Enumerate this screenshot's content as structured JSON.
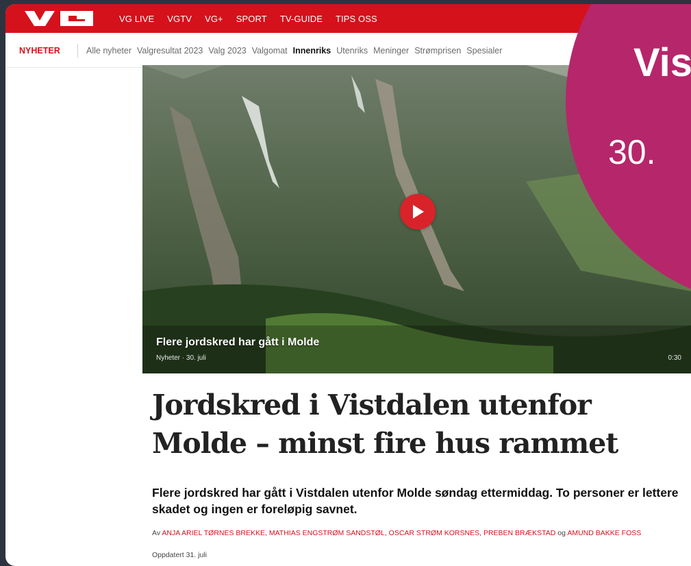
{
  "brand": {
    "logo_text": "VG",
    "accent": "#d5111b",
    "badge_color": "#b6266a"
  },
  "topnav": {
    "items": [
      {
        "label": "VG LIVE"
      },
      {
        "label": "VGTV"
      },
      {
        "label": "VG+"
      },
      {
        "label": "SPORT"
      },
      {
        "label": "TV-GUIDE"
      },
      {
        "label": "TIPS OSS"
      }
    ]
  },
  "secnav": {
    "section": "NYHETER",
    "items": [
      {
        "label": "Alle nyheter"
      },
      {
        "label": "Valgresultat 2023"
      },
      {
        "label": "Valg 2023"
      },
      {
        "label": "Valgomat"
      },
      {
        "label": "Innenriks"
      },
      {
        "label": "Utenriks"
      },
      {
        "label": "Meninger"
      },
      {
        "label": "Strømprisen"
      },
      {
        "label": "Spesialer"
      }
    ],
    "active": "Innenriks"
  },
  "video": {
    "title": "Flere jordskred har gått i Molde",
    "meta": "Nyheter · 30. juli",
    "duration": "0:30",
    "icon": "play-icon"
  },
  "badge": {
    "line1": "Vis",
    "line2": "30."
  },
  "article": {
    "headline": "Jordskred i Vistdalen utenfor Molde – minst fire hus rammet",
    "lead": "Flere jordskred har gått i Vistdalen utenfor Molde søndag ettermiddag. To personer er lettere skadet og ingen er foreløpig savnet.",
    "byline_prefix": "Av",
    "authors": [
      "ANJA ARIEL TØRNES BREKKE",
      "MATHIAS ENGSTRØM SANDSTØL",
      "OSCAR STRØM KORSNES",
      "PREBEN BRÆKSTAD",
      "AMUND BAKKE FOSS"
    ],
    "byline_sep": ", ",
    "byline_and": "og",
    "updated": "Oppdatert 31. juli"
  }
}
